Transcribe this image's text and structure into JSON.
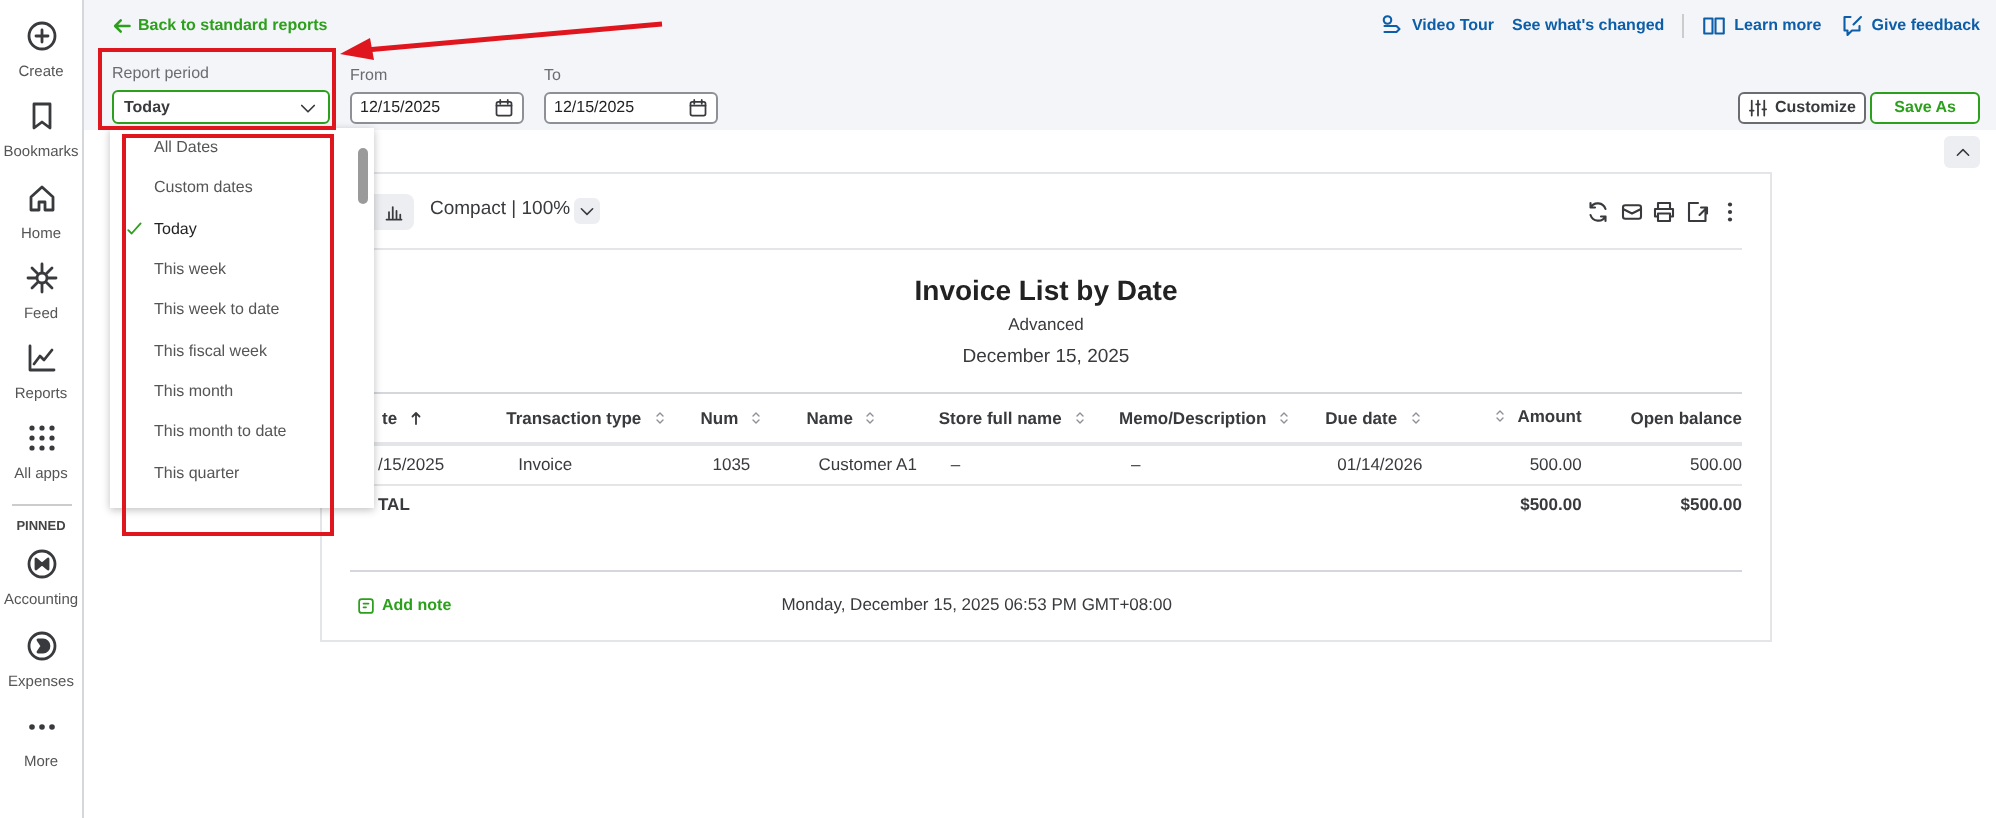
{
  "sidebar": {
    "items": [
      {
        "kind": "create",
        "label": "Create"
      },
      {
        "kind": "bookmarks",
        "label": "Bookmarks"
      },
      {
        "kind": "home",
        "label": "Home"
      },
      {
        "kind": "feed",
        "label": "Feed"
      },
      {
        "kind": "reports",
        "label": "Reports"
      },
      {
        "kind": "apps",
        "label": "All apps"
      }
    ],
    "pinned_heading": "PINNED",
    "pinned": [
      {
        "kind": "accounting",
        "label": "Accounting"
      },
      {
        "kind": "expenses",
        "label": "Expenses"
      },
      {
        "kind": "more",
        "label": "More"
      }
    ]
  },
  "header": {
    "back_link": "Back to standard reports",
    "report_period": {
      "label": "Report period",
      "value": "Today"
    },
    "from": {
      "label": "From",
      "value": "12/15/2025"
    },
    "to": {
      "label": "To",
      "value": "12/15/2025"
    },
    "links": [
      {
        "kind": "video",
        "label": "Video Tour"
      },
      {
        "kind": "plain",
        "label": "See what's changed"
      },
      {
        "kind": "book",
        "label": "Learn more"
      },
      {
        "kind": "feedback",
        "label": "Give feedback"
      }
    ],
    "customize": "Customize",
    "save_as": "Save As"
  },
  "dropdown": {
    "options": [
      {
        "label": "All Dates",
        "selected": false
      },
      {
        "label": "Custom dates",
        "selected": false
      },
      {
        "label": "Today",
        "selected": true
      },
      {
        "label": "This week",
        "selected": false
      },
      {
        "label": "This week to date",
        "selected": false
      },
      {
        "label": "This fiscal week",
        "selected": false
      },
      {
        "label": "This month",
        "selected": false
      },
      {
        "label": "This month to date",
        "selected": false
      },
      {
        "label": "This quarter",
        "selected": false
      }
    ]
  },
  "report": {
    "view": "Compact | 100%",
    "title": "Invoice List by Date",
    "subtitle": "Advanced",
    "date": "December 15, 2025",
    "columns": [
      {
        "label": "te",
        "sorted": true,
        "numeric": false
      },
      {
        "label": "Transaction type",
        "sorted": false,
        "numeric": false
      },
      {
        "label": "Num",
        "sorted": false,
        "numeric": false
      },
      {
        "label": "Name",
        "sorted": false,
        "numeric": false
      },
      {
        "label": "Store full name",
        "sorted": false,
        "numeric": false
      },
      {
        "label": "Memo/Description",
        "sorted": false,
        "numeric": false
      },
      {
        "label": "Due date",
        "sorted": false,
        "numeric": false
      },
      {
        "label": "Amount",
        "sorted": false,
        "numeric": true
      },
      {
        "label": "Open balance",
        "sorted": false,
        "sortable": false,
        "numeric": true
      }
    ],
    "rows": [
      {
        "cells": [
          "/15/2025",
          "Invoice",
          "1035",
          "Customer A1",
          "–",
          "–",
          "01/14/2026",
          "500.00",
          "500.00"
        ]
      }
    ],
    "total": {
      "cells": [
        "TAL",
        "",
        "",
        "",
        "",
        "",
        "",
        "$500.00",
        "$500.00"
      ]
    },
    "add_note": "Add note",
    "timestamp": "Monday, December 15, 2025 06:53 PM GMT+08:00"
  }
}
